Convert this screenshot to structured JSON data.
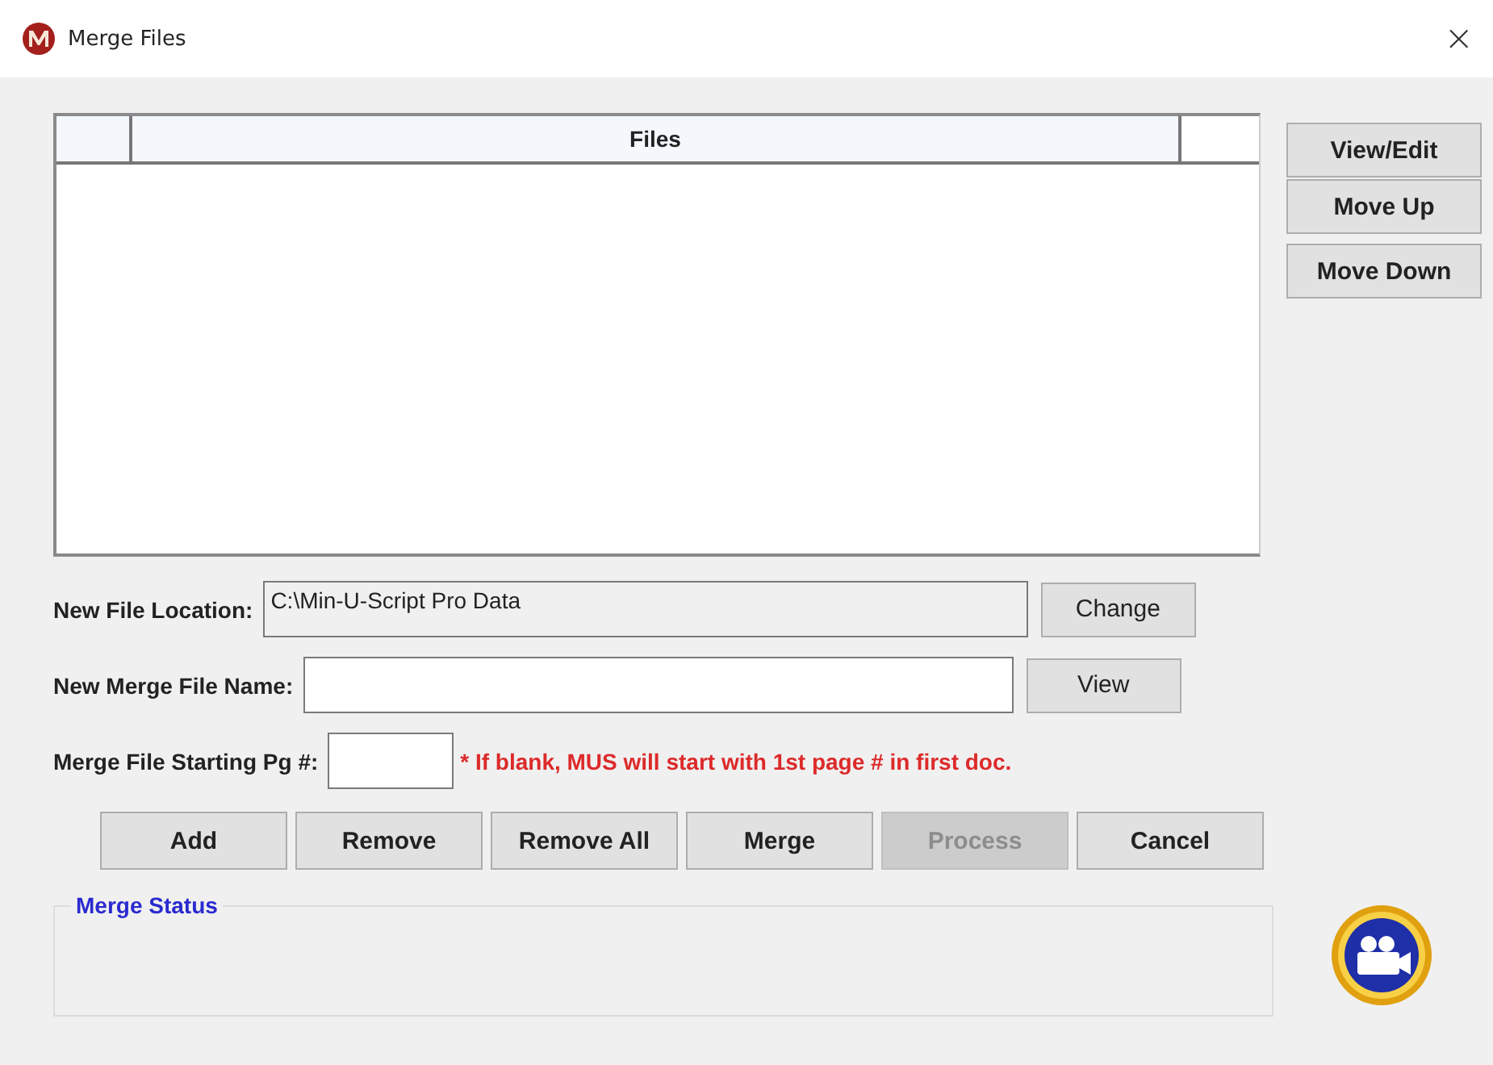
{
  "window": {
    "title": "Merge Files",
    "close": "×"
  },
  "table": {
    "columns": [
      {
        "kind": "blank"
      },
      {
        "kind": "text",
        "label": "Files"
      }
    ]
  },
  "side_buttons": [
    "View/Edit",
    "Move Up",
    "Move Down"
  ],
  "fields": [
    {
      "label": "New File Location:",
      "value": "C:\\Min-U-Script Pro Data",
      "readonly": true,
      "button": "Change"
    },
    {
      "label": "New Merge File Name:",
      "readonly": false,
      "button": "View"
    },
    {
      "label": "Merge File Starting Pg #:",
      "readonly": false,
      "note": "* If blank, MUS will start with 1st page # in first doc."
    }
  ],
  "buttons": [
    {
      "label": "Add",
      "disabled": false
    },
    {
      "label": "Remove",
      "disabled": false
    },
    {
      "label": "Remove All",
      "disabled": false
    },
    {
      "label": "Merge",
      "disabled": false
    },
    {
      "label": "Process",
      "disabled": true
    },
    {
      "label": "Cancel",
      "disabled": false
    }
  ],
  "status": {
    "legend": "Merge Status"
  }
}
